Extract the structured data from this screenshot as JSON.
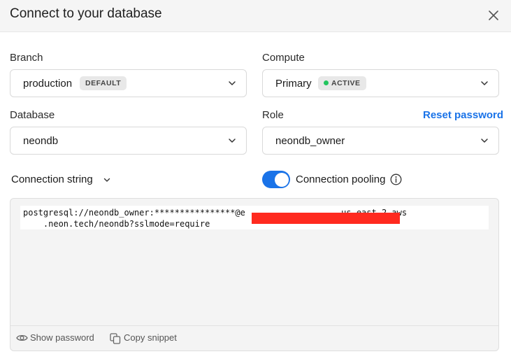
{
  "dialog": {
    "title": "Connect to your database"
  },
  "branch": {
    "label": "Branch",
    "value": "production",
    "badge": "DEFAULT"
  },
  "compute": {
    "label": "Compute",
    "value": "Primary",
    "badge": "ACTIVE",
    "status_color": "#22c55e"
  },
  "database": {
    "label": "Database",
    "value": "neondb"
  },
  "role": {
    "label": "Role",
    "value": "neondb_owner",
    "reset_link": "Reset password"
  },
  "connection": {
    "mode_label": "Connection string",
    "pooling_label": "Connection pooling",
    "pooling_enabled": true,
    "code_line1": "postgresql://neondb_owner:****************@e                  .us-east-2.aws",
    "code_line2": "    .neon.tech/neondb?sslmode=require",
    "show_password": "Show password",
    "copy_snippet": "Copy snippet"
  },
  "colors": {
    "accent": "#1a73e8",
    "redaction": "#ff2a1f"
  }
}
